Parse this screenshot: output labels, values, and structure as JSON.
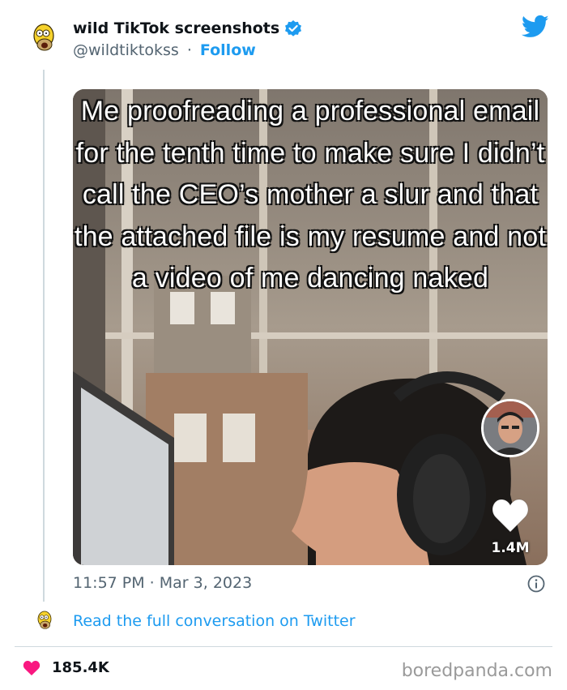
{
  "author": {
    "display_name": "wild TikTok screenshots",
    "handle": "@wildtiktokss",
    "separator": "·",
    "follow_label": "Follow"
  },
  "media": {
    "caption": "Me proofreading a professional email for the tenth time to make sure I didn’t call the CEO’s mother a slur and that the attached file is my resume and not a video of me dancing naked",
    "like_count": "1.4M"
  },
  "tweet": {
    "timestamp": "11:57 PM · Mar 3, 2023",
    "read_full_label": "Read the full conversation on Twitter",
    "likes": "185.4K"
  },
  "watermark": "boredpanda.com",
  "colors": {
    "accent": "#1d9bf0",
    "heart": "#f91880",
    "secondary_text": "#536471"
  },
  "icons": [
    "homer-avatar-icon",
    "verified-badge-icon",
    "twitter-bird-icon",
    "heart-icon",
    "info-icon"
  ]
}
